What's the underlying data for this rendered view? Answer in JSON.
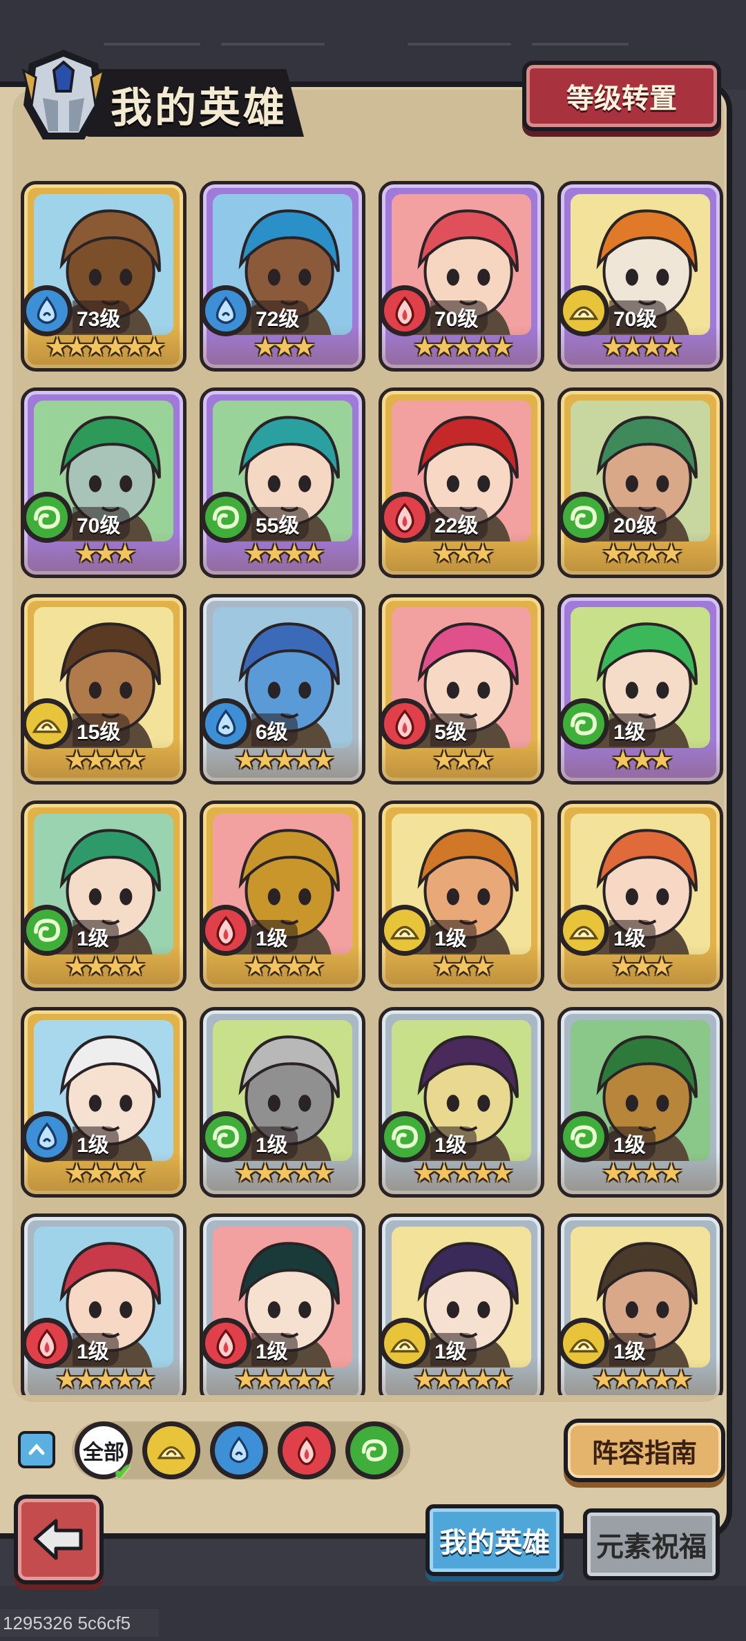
{
  "header": {
    "title": "我的英雄",
    "level_transfer_label": "等级转置"
  },
  "colors": {
    "water": "#3d8fd6",
    "fire": "#e0404a",
    "light": "#e8c43a",
    "wind": "#3fae3a"
  },
  "heroes": [
    {
      "level": "73级",
      "element": "water",
      "stars": "★★★★★★",
      "frame": "gold",
      "bg": "#9fd3ea",
      "hair": "#8a5a34",
      "skin": "#7a4f2a"
    },
    {
      "level": "72级",
      "element": "water",
      "stars": "★★★",
      "frame": "purple",
      "bg": "#8fc8e8",
      "hair": "#2b8fc8",
      "skin": "#8a5a3a"
    },
    {
      "level": "70级",
      "element": "fire",
      "stars": "★★★★★",
      "frame": "purple",
      "bg": "#f2a0a0",
      "hair": "#e0505a",
      "skin": "#f6d6c0"
    },
    {
      "level": "70级",
      "element": "light",
      "stars": "★★★★",
      "frame": "purple",
      "bg": "#f3e39a",
      "hair": "#e07a28",
      "skin": "#f0e6d8"
    },
    {
      "level": "70级",
      "element": "wind",
      "stars": "★★★",
      "frame": "purple",
      "bg": "#9ad39a",
      "hair": "#2e9a5a",
      "skin": "#a8c4b8"
    },
    {
      "level": "55级",
      "element": "wind",
      "stars": "★★★★",
      "frame": "purple",
      "bg": "#9ad39a",
      "hair": "#2aa0a0",
      "skin": "#f4d8c4"
    },
    {
      "level": "22级",
      "element": "fire",
      "stars": "★★★",
      "frame": "gold",
      "bg": "#f2a0a0",
      "hair": "#c42828",
      "skin": "#f6d8c4"
    },
    {
      "level": "20级",
      "element": "wind",
      "stars": "★★★★",
      "frame": "gold",
      "bg": "#c8d6a0",
      "hair": "#3e8a5a",
      "skin": "#d8a888"
    },
    {
      "level": "15级",
      "element": "light",
      "stars": "★★★★",
      "frame": "gold",
      "bg": "#f3e39a",
      "hair": "#5a3a22",
      "skin": "#b07a4a"
    },
    {
      "level": "6级",
      "element": "water",
      "stars": "★★★★★",
      "frame": "silver",
      "bg": "#9fc8e0",
      "hair": "#3a6ab8",
      "skin": "#5a9ad6"
    },
    {
      "level": "5级",
      "element": "fire",
      "stars": "★★★",
      "frame": "gold",
      "bg": "#f2a0a0",
      "hair": "#e0508a",
      "skin": "#f6d8c4"
    },
    {
      "level": "1级",
      "element": "wind",
      "stars": "★★★",
      "frame": "purple",
      "bg": "#c8e08a",
      "hair": "#3ab85a",
      "skin": "#f4dcc8"
    },
    {
      "level": "1级",
      "element": "wind",
      "stars": "★★★★",
      "frame": "gold",
      "bg": "#9ad3b0",
      "hair": "#2e9a6a",
      "skin": "#f4dcc8"
    },
    {
      "level": "1级",
      "element": "fire",
      "stars": "★★★★",
      "frame": "gold",
      "bg": "#f2a0a0",
      "hair": "#c8962a",
      "skin": "#c8962a"
    },
    {
      "level": "1级",
      "element": "light",
      "stars": "★★★",
      "frame": "gold",
      "bg": "#f3e39a",
      "hair": "#d07828",
      "skin": "#e8a878"
    },
    {
      "level": "1级",
      "element": "light",
      "stars": "★★★",
      "frame": "gold",
      "bg": "#f3e39a",
      "hair": "#e06a3a",
      "skin": "#f6d8c4"
    },
    {
      "level": "1级",
      "element": "water",
      "stars": "★★★★",
      "frame": "gold",
      "bg": "#a8d8ee",
      "hair": "#eeeeee",
      "skin": "#f6e0d0"
    },
    {
      "level": "1级",
      "element": "wind",
      "stars": "★★★★★",
      "frame": "silver",
      "bg": "#c8e08a",
      "hair": "#b8b8b8",
      "skin": "#909090"
    },
    {
      "level": "1级",
      "element": "wind",
      "stars": "★★★★★",
      "frame": "silver",
      "bg": "#c8e08a",
      "hair": "#4a2a5a",
      "skin": "#e8d890"
    },
    {
      "level": "1级",
      "element": "wind",
      "stars": "★★★★",
      "frame": "silver",
      "bg": "#8ac88a",
      "hair": "#2e7a3a",
      "skin": "#b8863a"
    },
    {
      "level": "1级",
      "element": "fire",
      "stars": "★★★★★",
      "frame": "silver",
      "bg": "#9fd3ea",
      "hair": "#c83a4a",
      "skin": "#f6d8c4"
    },
    {
      "level": "1级",
      "element": "fire",
      "stars": "★★★★★",
      "frame": "silver",
      "bg": "#f2a0a0",
      "hair": "#1a3a3a",
      "skin": "#f6e0d0"
    },
    {
      "level": "1级",
      "element": "light",
      "stars": "★★★★★",
      "frame": "silver",
      "bg": "#f3e39a",
      "hair": "#3a2a5a",
      "skin": "#f6e0d0"
    },
    {
      "level": "1级",
      "element": "light",
      "stars": "★★★★★",
      "frame": "silver",
      "bg": "#f3e39a",
      "hair": "#4a3a2a",
      "skin": "#d8a888"
    }
  ],
  "filters": {
    "all_label": "全部",
    "elements": [
      "light",
      "water",
      "fire",
      "wind"
    ]
  },
  "lineup_guide_label": "阵容指南",
  "tabs": {
    "my_heroes": "我的英雄",
    "element_blessing": "元素祝福"
  },
  "footer_id": "1295326 5c6cf5"
}
